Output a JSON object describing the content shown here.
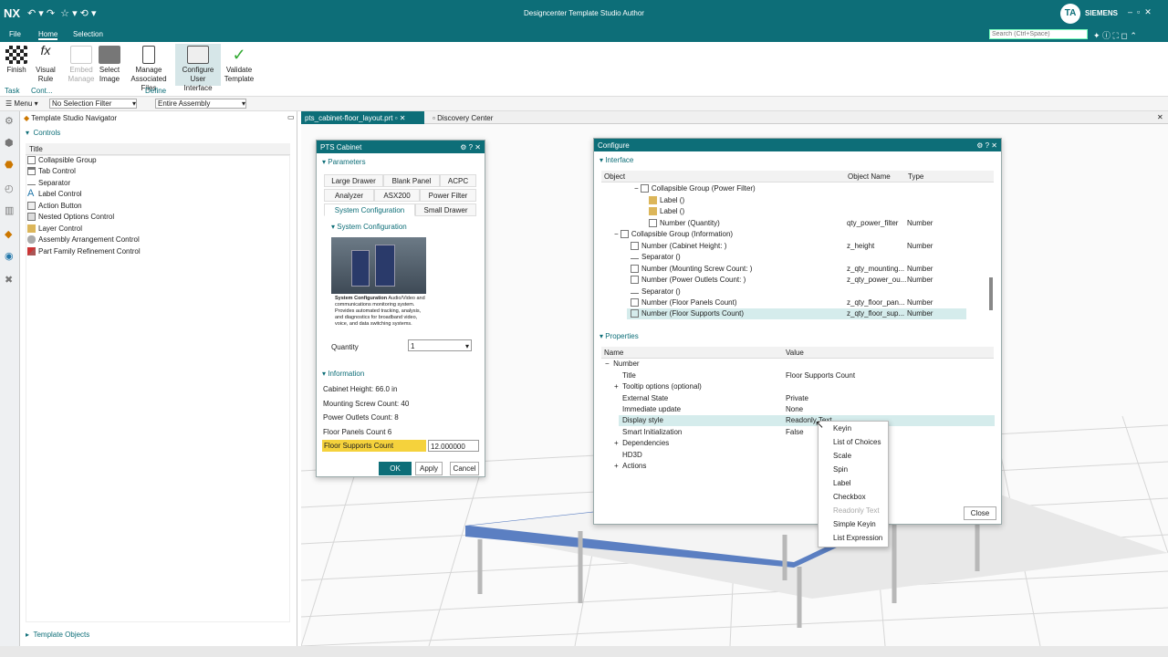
{
  "app": {
    "logo": "NX",
    "title": "Designcenter Template Studio Author",
    "user_initials": "TA",
    "brand": "SIEMENS",
    "accent_color": "#0d6e78"
  },
  "ribbon_tabs": [
    "File",
    "Home",
    "Selection"
  ],
  "search": {
    "placeholder": "Search (Ctrl+Space)"
  },
  "ribbon": {
    "buttons": [
      {
        "label1": "Finish",
        "label2": ""
      },
      {
        "label1": "Visual",
        "label2": "Rule"
      },
      {
        "label1": "Embed",
        "label2": "Manage"
      },
      {
        "label1": "Select",
        "label2": "Image"
      },
      {
        "label1": "Manage",
        "label2": "Associated Files"
      },
      {
        "label1": "Configure",
        "label2": "User Interface"
      },
      {
        "label1": "Validate",
        "label2": "Template"
      }
    ],
    "groups": [
      "Task",
      "Cont...",
      "Define"
    ]
  },
  "toolbar": {
    "menu": "Menu",
    "filter": "No Selection Filter",
    "scope": "Entire Assembly"
  },
  "navigator": {
    "title": "Template Studio Navigator",
    "section": "Controls",
    "column": "Title",
    "items": [
      "Collapsible Group",
      "Tab Control",
      "Separator",
      "Label Control",
      "Action Button",
      "Nested Options Control",
      "Layer Control",
      "Assembly Arrangement Control",
      "Part Family Refinement Control"
    ],
    "footer": "Template Objects"
  },
  "doc_tabs": [
    "pts_cabinet-floor_layout.prt",
    "Discovery Center"
  ],
  "pts_dialog": {
    "title": "PTS Cabinet",
    "parameters": "Parameters",
    "tabs_row1": [
      "Large Drawer",
      "Blank Panel",
      "ACPC"
    ],
    "tabs_row2": [
      "Analyzer",
      "ASX200",
      "Power Filter"
    ],
    "tabs_row3": [
      "System Configuration",
      "Small Drawer"
    ],
    "subsection": "System Configuration",
    "caption_bold": "System Configuration",
    "caption_rest": " Audio/Video and communications monitoring system. Provides automated tracking, analysis, and diagnostics for broadband video, voice, and data switching systems.",
    "quantity_label": "Quantity",
    "quantity_value": "1",
    "information": "Information",
    "info_lines": [
      "Cabinet Height:  66.0 in",
      "Mounting Screw Count:  40",
      "Power Outlets Count:  8",
      "Floor Panels Count 6"
    ],
    "supports_label": "Floor Supports Count",
    "supports_value": "12.000000",
    "ok": "OK",
    "apply": "Apply",
    "cancel": "Cancel"
  },
  "configure": {
    "title": "Configure",
    "interface": "Interface",
    "columns": [
      "Object",
      "Object Name",
      "Type"
    ],
    "rows": [
      {
        "obj": "Collapsible Group (Power Filter)",
        "name": "",
        "type": ""
      },
      {
        "obj": "Label ()",
        "name": "",
        "type": ""
      },
      {
        "obj": "Label ()",
        "name": "",
        "type": ""
      },
      {
        "obj": "Number (Quantity)",
        "name": "qty_power_filter",
        "type": "Number"
      },
      {
        "obj": "Collapsible Group (Information)",
        "name": "",
        "type": ""
      },
      {
        "obj": "Number (Cabinet Height: )",
        "name": "z_height",
        "type": "Number"
      },
      {
        "obj": "Separator ()",
        "name": "",
        "type": ""
      },
      {
        "obj": "Number (Mounting Screw Count: )",
        "name": "z_qty_mounting...",
        "type": "Number"
      },
      {
        "obj": "Number (Power Outlets Count: )",
        "name": "z_qty_power_ou...",
        "type": "Number"
      },
      {
        "obj": "Separator ()",
        "name": "",
        "type": ""
      },
      {
        "obj": "Number (Floor Panels Count)",
        "name": "z_qty_floor_pan...",
        "type": "Number"
      },
      {
        "obj": "Number (Floor Supports Count)",
        "name": "z_qty_floor_sup...",
        "type": "Number"
      }
    ],
    "properties": "Properties",
    "prop_columns": [
      "Name",
      "Value"
    ],
    "props": [
      {
        "name": "Number",
        "value": ""
      },
      {
        "name": "Title",
        "value": "Floor Supports Count"
      },
      {
        "name": "Tooltip options (optional)",
        "value": ""
      },
      {
        "name": "External State",
        "value": "Private"
      },
      {
        "name": "Immediate update",
        "value": "None"
      },
      {
        "name": "Display style",
        "value": "Readonly Text"
      },
      {
        "name": "Smart Initialization",
        "value": "False"
      },
      {
        "name": "Dependencies",
        "value": ""
      },
      {
        "name": "HD3D",
        "value": ""
      },
      {
        "name": "Actions",
        "value": ""
      }
    ],
    "close": "Close"
  },
  "dropdown": [
    "Keyin",
    "List of Choices",
    "Scale",
    "Spin",
    "Label",
    "Checkbox",
    "Readonly Text",
    "Simple Keyin",
    "List Expression"
  ]
}
